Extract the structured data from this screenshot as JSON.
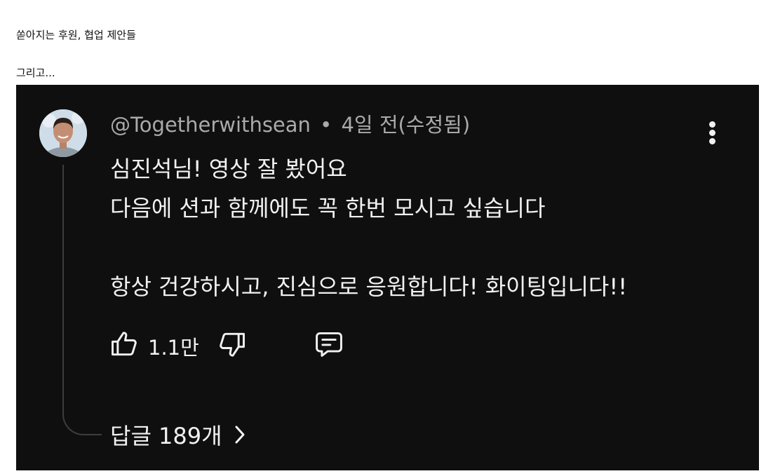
{
  "blog": {
    "line1": "쏟아지는 후원, 협업 제안들",
    "line2": "그리고..."
  },
  "comment": {
    "author": "@Togetherwithsean",
    "separator": "•",
    "time": "4일 전(수정됨)",
    "lines": [
      "심진석님! 영상 잘 봤어요",
      "다음에 션과 함께에도 꼭 한번 모시고 싶습니다",
      "",
      "항상 건강하시고, 진심으로 응원합니다! 화이팅입니다!!"
    ],
    "like_count": "1.1만",
    "replies_label": "답글 189개"
  },
  "icons": {
    "like": "thumbs-up-icon",
    "dislike": "thumbs-down-icon",
    "reply": "comment-icon",
    "more": "more-vertical-icon",
    "replies": "chevron-right-icon"
  },
  "colors": {
    "panel_bg": "#0f0f0f",
    "text_primary": "#f1f1f1",
    "text_secondary": "#aaaaaa",
    "thread_line": "#3d3d3d"
  }
}
